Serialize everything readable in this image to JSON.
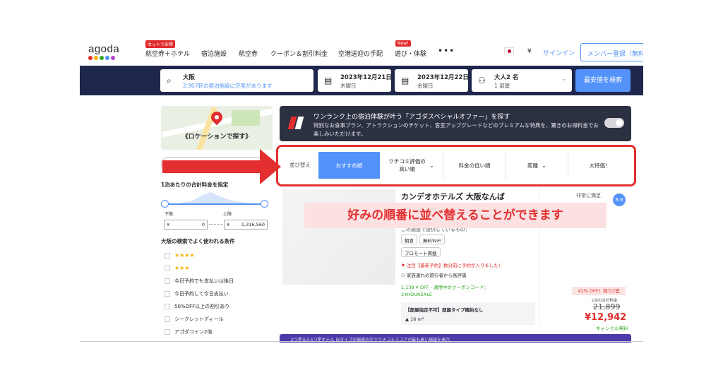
{
  "logo": {
    "text": "agoda",
    "dot_colors": [
      "#e12d2d",
      "#f4b400",
      "#32a923",
      "#5392f9",
      "#b43ed1"
    ]
  },
  "nav": {
    "items": [
      {
        "label": "航空券＋ホテル",
        "badge": "セットでお得"
      },
      {
        "label": "宿泊施設"
      },
      {
        "label": "航空券"
      },
      {
        "label": "クーポン＆割引料金"
      },
      {
        "label": "空港送迎の手配"
      },
      {
        "label": "遊び・体験",
        "badge": "New!"
      }
    ],
    "more": "•••",
    "currency": "¥",
    "signin": "サインイン",
    "register": "メンバー登録（無料）"
  },
  "search": {
    "destination": "大阪",
    "destination_sub": "2,907軒の宿泊施設に空室があります",
    "checkin": "2023年12月21日",
    "checkin_day": "木曜日",
    "checkout": "2023年12月22日",
    "checkout_day": "金曜日",
    "guests": "大人2 名",
    "rooms": "1 部屋",
    "button": "最安値を検索"
  },
  "sidebar": {
    "map_label": "《ロケーションで探す》",
    "price_title": "1泊あたりの合計料金を指定",
    "min_label": "下限",
    "max_label": "上限",
    "currency": "¥",
    "min_value": "0",
    "max_value": "1,316,560",
    "filters_title": "大阪の検索でよく使われる条件",
    "filters": [
      {
        "label": "★★★★",
        "stars": true
      },
      {
        "label": "★★★",
        "stars": true
      },
      {
        "label": "今日予約でも支払いは後日"
      },
      {
        "label": "今日予約して今日支払い"
      },
      {
        "label": "50%OFF以上の割引あり"
      },
      {
        "label": "シークレットディール"
      },
      {
        "label": "アゴダコイン2倍"
      }
    ]
  },
  "offer": {
    "title": "ワンランク上の宿泊体験が叶う「アゴダスペシャルオファー」を探す",
    "body": "特別なお食事プラン、アトラクションのチケット、客室アップグレードなどのプレミアムな特典を、驚きのお得料金でお楽しみいただけます。"
  },
  "sort": {
    "label": "並び替え",
    "tabs": [
      {
        "label": "おすすめ順",
        "active": true
      },
      {
        "label": "クチコミ評価の\n高い順",
        "chevron": true
      },
      {
        "label": "料金の低い順"
      },
      {
        "label": "距離",
        "chevron": true
      },
      {
        "label": "大特価！"
      }
    ]
  },
  "hotel": {
    "name": "カンデオホテルズ 大阪なんば",
    "desc": "この施設で提供しているもの：",
    "tags": [
      "朝食",
      "無料WiFi"
    ],
    "promo": "プロモート掲載",
    "note_urgent": "注目【最新予約】数分前に予約が入りました!",
    "note_family": "家族連れの旅行者から高評価",
    "coupon_line1": "1,138 ¥ OFF - 適用中のクーポンコード：",
    "coupon_line2": "24HOURSALE",
    "room_line1": "【部屋指定不可】部屋タイプ確約なし",
    "room_line2": "16 m²",
    "rating_label": "非常に満足",
    "rating": "8.6",
    "discount": "41% OFF！残り2室",
    "per_night": "1泊の合計料金",
    "old_price": "21,899",
    "new_price": "¥12,942",
    "cancel": "キャンセル無料"
  },
  "callout": "好みの順番に並べ替えることができます",
  "bottom_strip": "2つ星＆3.5つ星ホテル 日タイプの施設の中でクチコミスコアが最も高い施設を表示"
}
